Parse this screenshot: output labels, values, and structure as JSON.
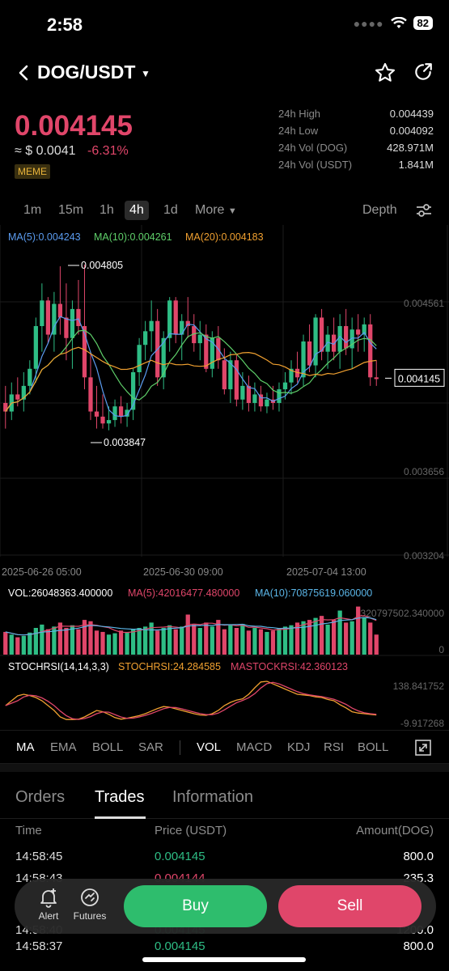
{
  "status": {
    "time": "2:58",
    "battery": "82"
  },
  "header": {
    "pair": "DOG/USDT"
  },
  "price": {
    "last": "0.004145",
    "approx": "≈ $ 0.0041",
    "change": "-6.31%",
    "tag": "MEME"
  },
  "stats": [
    {
      "label": "24h High",
      "value": "0.004439"
    },
    {
      "label": "24h Low",
      "value": "0.004092"
    },
    {
      "label": "24h Vol (DOG)",
      "value": "428.971M"
    },
    {
      "label": "24h Vol (USDT)",
      "value": "1.841M"
    }
  ],
  "timeframes": [
    "1m",
    "15m",
    "1h",
    "4h",
    "1d",
    "More"
  ],
  "active_timeframe": "4h",
  "depth_label": "Depth",
  "ma_legend": [
    {
      "text": "MA(5):0.004243",
      "color": "#5b9cf0"
    },
    {
      "text": "MA(10):0.004261",
      "color": "#5fd06a"
    },
    {
      "text": "MA(20):0.004183",
      "color": "#f0a030"
    }
  ],
  "price_axis": [
    "0.004561",
    "0.003656",
    "0.003204"
  ],
  "current_price_tag": "0.004145",
  "high_marker": "0.004805",
  "low_marker": "0.003847",
  "date_axis": [
    "2025-06-26 05:00",
    "2025-06-30 09:00",
    "2025-07-04 13:00"
  ],
  "vol_legend": [
    {
      "text": "VOL:26048363.400000",
      "color": "#ffffff"
    },
    {
      "text": "MA(5):42016477.480000",
      "color": "#e0466a"
    },
    {
      "text": "MA(10):70875619.060000",
      "color": "#5bb6e8"
    }
  ],
  "vol_axis": [
    "320797502.340000",
    "0"
  ],
  "stoch_legend": [
    {
      "text": "STOCHRSI(14,14,3,3)",
      "color": "#ffffff"
    },
    {
      "text": "STOCHRSI:24.284585",
      "color": "#f0a030"
    },
    {
      "text": "MASTOCKRSI:42.360123",
      "color": "#e0466a"
    }
  ],
  "stoch_axis": [
    "138.841752",
    "-9.917268"
  ],
  "indicators_main": [
    "MA",
    "EMA",
    "BOLL",
    "SAR"
  ],
  "indicators_sub": [
    "VOL",
    "MACD",
    "KDJ",
    "RSI",
    "BOLL"
  ],
  "tabs": [
    "Orders",
    "Trades",
    "Information"
  ],
  "active_tab": "Trades",
  "trade_headers": {
    "time": "Time",
    "price": "Price (USDT)",
    "amount": "Amount(DOG)"
  },
  "trades": [
    {
      "time": "14:58:45",
      "price": "0.004145",
      "amount": "800.0",
      "side": "buy"
    },
    {
      "time": "14:58:43",
      "price": "0.004144",
      "amount": "235.3",
      "side": "sell"
    },
    {
      "time": "14:58:40",
      "price": "0.004145",
      "amount": "1200.0",
      "side": "buy"
    },
    {
      "time": "14:58:37",
      "price": "0.004145",
      "amount": "800.0",
      "side": "buy"
    }
  ],
  "actions": {
    "alert": "Alert",
    "futures": "Futures",
    "buy": "Buy",
    "sell": "Sell"
  },
  "colors": {
    "up": "#2ebd85",
    "down": "#e0466a",
    "accent": "#f0a030"
  },
  "chart_data": {
    "type": "candlestick",
    "interval": "4h",
    "price_range": [
      0.0031,
      0.0049
    ],
    "candles": [
      {
        "o": 0.004,
        "h": 0.0041,
        "l": 0.00385,
        "c": 0.00395
      },
      {
        "o": 0.00395,
        "h": 0.00412,
        "l": 0.0039,
        "c": 0.00405
      },
      {
        "o": 0.00405,
        "h": 0.00415,
        "l": 0.00398,
        "c": 0.00402
      },
      {
        "o": 0.00402,
        "h": 0.00418,
        "l": 0.00395,
        "c": 0.0041
      },
      {
        "o": 0.0041,
        "h": 0.00425,
        "l": 0.00405,
        "c": 0.0042
      },
      {
        "o": 0.0042,
        "h": 0.0045,
        "l": 0.00412,
        "c": 0.00445
      },
      {
        "o": 0.00445,
        "h": 0.0047,
        "l": 0.0043,
        "c": 0.0046
      },
      {
        "o": 0.0046,
        "h": 0.00462,
        "l": 0.00435,
        "c": 0.0044
      },
      {
        "o": 0.0044,
        "h": 0.00465,
        "l": 0.0043,
        "c": 0.00458
      },
      {
        "o": 0.00458,
        "h": 0.0048,
        "l": 0.0044,
        "c": 0.0045
      },
      {
        "o": 0.0045,
        "h": 0.0047,
        "l": 0.00425,
        "c": 0.00438
      },
      {
        "o": 0.00438,
        "h": 0.0046,
        "l": 0.0042,
        "c": 0.00455
      },
      {
        "o": 0.00455,
        "h": 0.00472,
        "l": 0.0044,
        "c": 0.00445
      },
      {
        "o": 0.00445,
        "h": 0.00481,
        "l": 0.00408,
        "c": 0.00415
      },
      {
        "o": 0.00415,
        "h": 0.0043,
        "l": 0.0039,
        "c": 0.00395
      },
      {
        "o": 0.00395,
        "h": 0.0041,
        "l": 0.00385,
        "c": 0.00392
      },
      {
        "o": 0.00392,
        "h": 0.00405,
        "l": 0.00385,
        "c": 0.00388
      },
      {
        "o": 0.00388,
        "h": 0.00398,
        "l": 0.00384,
        "c": 0.0039
      },
      {
        "o": 0.0039,
        "h": 0.00402,
        "l": 0.00386,
        "c": 0.00398
      },
      {
        "o": 0.00398,
        "h": 0.00404,
        "l": 0.00388,
        "c": 0.00392
      },
      {
        "o": 0.00392,
        "h": 0.004,
        "l": 0.00386,
        "c": 0.00396
      },
      {
        "o": 0.00396,
        "h": 0.0042,
        "l": 0.0039,
        "c": 0.00418
      },
      {
        "o": 0.00418,
        "h": 0.00438,
        "l": 0.0041,
        "c": 0.00434
      },
      {
        "o": 0.00434,
        "h": 0.00448,
        "l": 0.00425,
        "c": 0.00442
      },
      {
        "o": 0.00442,
        "h": 0.0046,
        "l": 0.0043,
        "c": 0.00448
      },
      {
        "o": 0.00448,
        "h": 0.00455,
        "l": 0.0041,
        "c": 0.00415
      },
      {
        "o": 0.00415,
        "h": 0.00442,
        "l": 0.00408,
        "c": 0.00438
      },
      {
        "o": 0.00438,
        "h": 0.00462,
        "l": 0.0043,
        "c": 0.0046
      },
      {
        "o": 0.0046,
        "h": 0.00462,
        "l": 0.00435,
        "c": 0.0044
      },
      {
        "o": 0.0044,
        "h": 0.00452,
        "l": 0.00425,
        "c": 0.00448
      },
      {
        "o": 0.00448,
        "h": 0.00462,
        "l": 0.00438,
        "c": 0.00445
      },
      {
        "o": 0.00445,
        "h": 0.00452,
        "l": 0.0043,
        "c": 0.00435
      },
      {
        "o": 0.00435,
        "h": 0.00448,
        "l": 0.00425,
        "c": 0.0044
      },
      {
        "o": 0.0044,
        "h": 0.00446,
        "l": 0.00418,
        "c": 0.0042
      },
      {
        "o": 0.0042,
        "h": 0.00442,
        "l": 0.00415,
        "c": 0.00438
      },
      {
        "o": 0.00438,
        "h": 0.00445,
        "l": 0.0042,
        "c": 0.00425
      },
      {
        "o": 0.00425,
        "h": 0.00432,
        "l": 0.00405,
        "c": 0.00408
      },
      {
        "o": 0.00408,
        "h": 0.0043,
        "l": 0.004,
        "c": 0.00425
      },
      {
        "o": 0.00425,
        "h": 0.00428,
        "l": 0.00398,
        "c": 0.00402
      },
      {
        "o": 0.00402,
        "h": 0.00418,
        "l": 0.00396,
        "c": 0.0041
      },
      {
        "o": 0.0041,
        "h": 0.00416,
        "l": 0.00395,
        "c": 0.004
      },
      {
        "o": 0.004,
        "h": 0.00412,
        "l": 0.00395,
        "c": 0.00405
      },
      {
        "o": 0.00405,
        "h": 0.0041,
        "l": 0.00395,
        "c": 0.00398
      },
      {
        "o": 0.00398,
        "h": 0.00406,
        "l": 0.00394,
        "c": 0.00402
      },
      {
        "o": 0.00402,
        "h": 0.0041,
        "l": 0.00396,
        "c": 0.004
      },
      {
        "o": 0.004,
        "h": 0.00412,
        "l": 0.00395,
        "c": 0.00408
      },
      {
        "o": 0.00408,
        "h": 0.00418,
        "l": 0.00402,
        "c": 0.00412
      },
      {
        "o": 0.00412,
        "h": 0.00425,
        "l": 0.00405,
        "c": 0.0042
      },
      {
        "o": 0.0042,
        "h": 0.0043,
        "l": 0.00412,
        "c": 0.00415
      },
      {
        "o": 0.00415,
        "h": 0.0044,
        "l": 0.0041,
        "c": 0.00436
      },
      {
        "o": 0.00436,
        "h": 0.00446,
        "l": 0.00418,
        "c": 0.00422
      },
      {
        "o": 0.00422,
        "h": 0.00452,
        "l": 0.00415,
        "c": 0.0045
      },
      {
        "o": 0.0045,
        "h": 0.00455,
        "l": 0.00425,
        "c": 0.0043
      },
      {
        "o": 0.0043,
        "h": 0.00445,
        "l": 0.0042,
        "c": 0.0044
      },
      {
        "o": 0.0044,
        "h": 0.0045,
        "l": 0.00425,
        "c": 0.0043
      },
      {
        "o": 0.0043,
        "h": 0.00452,
        "l": 0.0042,
        "c": 0.00445
      },
      {
        "o": 0.00445,
        "h": 0.00455,
        "l": 0.00428,
        "c": 0.00432
      },
      {
        "o": 0.00432,
        "h": 0.0045,
        "l": 0.0042,
        "c": 0.00443
      },
      {
        "o": 0.00443,
        "h": 0.00452,
        "l": 0.0043,
        "c": 0.0044
      },
      {
        "o": 0.0044,
        "h": 0.0045,
        "l": 0.0043,
        "c": 0.00446
      },
      {
        "o": 0.00446,
        "h": 0.00452,
        "l": 0.0041,
        "c": 0.00415
      },
      {
        "o": 0.00415,
        "h": 0.00425,
        "l": 0.0041,
        "c": 0.00414
      }
    ],
    "volume": [
      34,
      30,
      26,
      28,
      33,
      40,
      45,
      38,
      42,
      48,
      40,
      44,
      38,
      52,
      50,
      36,
      34,
      30,
      32,
      36,
      34,
      38,
      40,
      42,
      48,
      36,
      40,
      44,
      38,
      42,
      60,
      45,
      40,
      48,
      42,
      52,
      38,
      44,
      40,
      46,
      36,
      40,
      38,
      34,
      36,
      40,
      42,
      44,
      48,
      50,
      52,
      55,
      58,
      45,
      52,
      66,
      48,
      50,
      72,
      56,
      48,
      30
    ],
    "stochrsi": [
      45,
      60,
      75,
      80,
      76,
      70,
      60,
      45,
      30,
      10,
      2,
      2,
      3,
      10,
      20,
      30,
      26,
      18,
      8,
      3,
      6,
      10,
      14,
      20,
      28,
      36,
      42,
      40,
      35,
      30,
      25,
      20,
      16,
      15,
      20,
      30,
      45,
      55,
      62,
      66,
      80,
      100,
      118,
      120,
      112,
      104,
      96,
      88,
      80,
      78,
      76,
      72,
      70,
      64,
      60,
      48,
      38,
      26,
      22,
      20,
      18,
      16
    ]
  }
}
